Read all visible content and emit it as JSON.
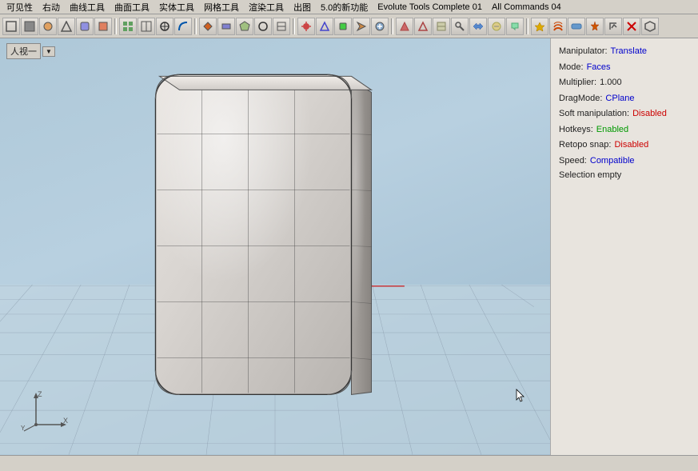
{
  "menubar": {
    "items": [
      "可见性",
      "右动",
      "曲线工具",
      "曲面工具",
      "实体工具",
      "网格工具",
      "渲染工具",
      "出图",
      "5.0的新功能",
      "Evolute Tools Complete 01",
      "All Commands 04"
    ]
  },
  "toolbar": {
    "buttons": [
      "⬜",
      "⬛",
      "◻",
      "🔲",
      "▣",
      "◈",
      "⧈",
      "▦",
      "⊞",
      "⊟",
      "⊠",
      "⊡",
      "◎",
      "●",
      "◉",
      "○",
      "⊕",
      "⊗",
      "⊘",
      "⊙",
      "△",
      "▲",
      "▷",
      "▶",
      "◁",
      "◀",
      "▽",
      "▼",
      "◆",
      "◇",
      "⬡",
      "⬢",
      "✦",
      "✧",
      "❖",
      "✿",
      "❀",
      "✾",
      "⚙",
      "⛭"
    ]
  },
  "viewport": {
    "view_label": "人视一",
    "view_label_arrow": "▼"
  },
  "info_panel": {
    "manipulator_label": "Manipulator:",
    "manipulator_value": "Translate",
    "mode_label": "Mode:",
    "mode_value": "Faces",
    "multiplier_label": "Multiplier:",
    "multiplier_value": "1.000",
    "dragmode_label": "DragMode:",
    "dragmode_value": "CPlane",
    "soft_label": "Soft manipulation:",
    "soft_value": "Disabled",
    "hotkeys_label": "Hotkeys:",
    "hotkeys_value": "Enabled",
    "retopo_label": "Retopo snap:",
    "retopo_value": "Disabled",
    "speed_label": "Speed:",
    "speed_value": "Compatible",
    "selection_text": "Selection empty"
  },
  "status_bar": {
    "text": ""
  },
  "colors": {
    "accent_blue": "#0000cc",
    "accent_red": "#cc0000",
    "accent_green": "#009900",
    "viewport_bg_top": "#b0c8d8",
    "viewport_bg_bottom": "#9ab8cc"
  }
}
